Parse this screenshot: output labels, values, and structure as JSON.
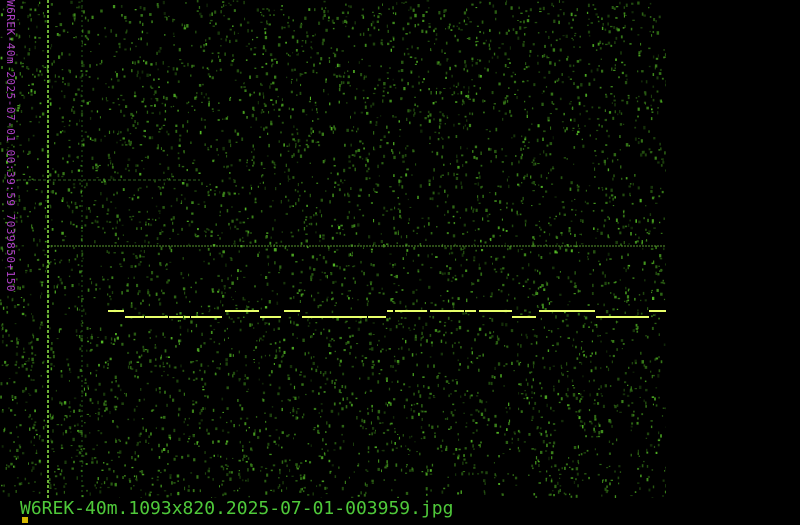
{
  "image": {
    "side_label": "W6REK-40m 2025-07-01 00:39:59 7039850+150",
    "footer_label": "W6REK-40m.1093x820.2025-07-01-003959.jpg"
  },
  "colors": {
    "background": "#000000",
    "noise": "#3fa12a",
    "signal": "#e8ff6a",
    "label": "#b040c8",
    "footer": "#4fc93a",
    "cursor": "#d4b800"
  }
}
